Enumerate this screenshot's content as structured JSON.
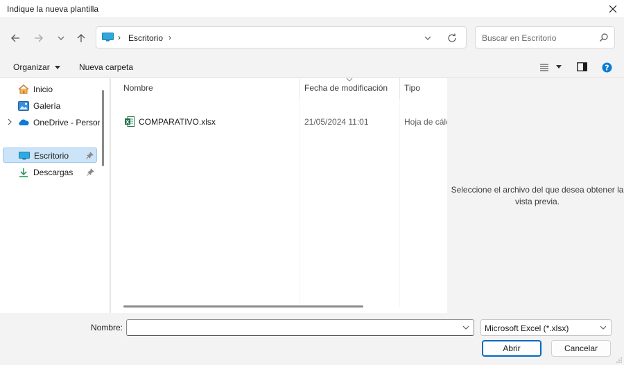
{
  "window": {
    "title": "Indique la nueva plantilla"
  },
  "address": {
    "location": "Escritorio",
    "separator": "›"
  },
  "search": {
    "placeholder": "Buscar en Escritorio"
  },
  "toolbar": {
    "organize_label": "Organizar",
    "new_folder_label": "Nueva carpeta"
  },
  "sidebar": {
    "items": [
      {
        "label": "Inicio",
        "icon": "home-icon"
      },
      {
        "label": "Galería",
        "icon": "gallery-icon"
      },
      {
        "label": "OneDrive - Personal",
        "icon": "onedrive-icon"
      },
      {
        "label": "Escritorio",
        "icon": "desktop-icon",
        "selected": true,
        "pinned": true
      },
      {
        "label": "Descargas",
        "icon": "download-icon",
        "pinned": true
      }
    ]
  },
  "columns": {
    "name": "Nombre",
    "date": "Fecha de modificación",
    "type": "Tipo"
  },
  "files": [
    {
      "name": "COMPARATIVO.xlsx",
      "date": "21/05/2024 11:01",
      "type": "Hoja de cálculo",
      "icon": "excel-file-icon"
    }
  ],
  "preview": {
    "message": "Seleccione el archivo del que desea obtener la vista previa."
  },
  "footer": {
    "name_label": "Nombre:",
    "name_value": "",
    "file_type": "Microsoft Excel (*.xlsx)",
    "open_label": "Abrir",
    "cancel_label": "Cancelar"
  },
  "colors": {
    "accent": "#0067c0",
    "selection": "#cce4f7",
    "help": "#0a7cd6",
    "excel": "#1d6f42"
  }
}
